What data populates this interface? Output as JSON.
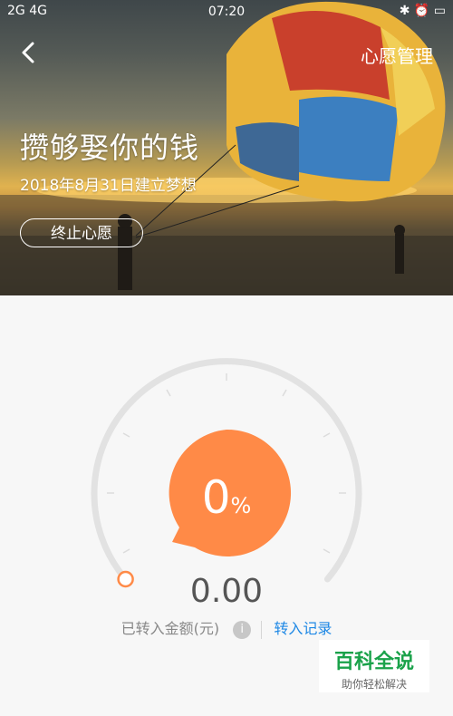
{
  "status_bar": {
    "signal_left": "2G 4G",
    "time": "07:20",
    "right_icons": [
      "bluetooth-icon",
      "alarm-icon",
      "battery-icon"
    ]
  },
  "header": {
    "manage_label": "心愿管理"
  },
  "wish": {
    "title": "攒够娶你的钱",
    "subtitle": "2018年8月31日建立梦想",
    "terminate_label": "终止心愿"
  },
  "progress": {
    "percent_value": "0",
    "percent_symbol": "%",
    "fraction": 0,
    "amount": "0.00",
    "amount_label": "已转入金额(元)",
    "info_label": "i",
    "record_label": "转入记录"
  },
  "colors": {
    "accent": "#ff8a47",
    "link": "#1e88e5",
    "gauge_track": "#e2e2e2"
  },
  "watermark": {
    "line1": "百科全说",
    "line2": "助你轻松解决"
  }
}
